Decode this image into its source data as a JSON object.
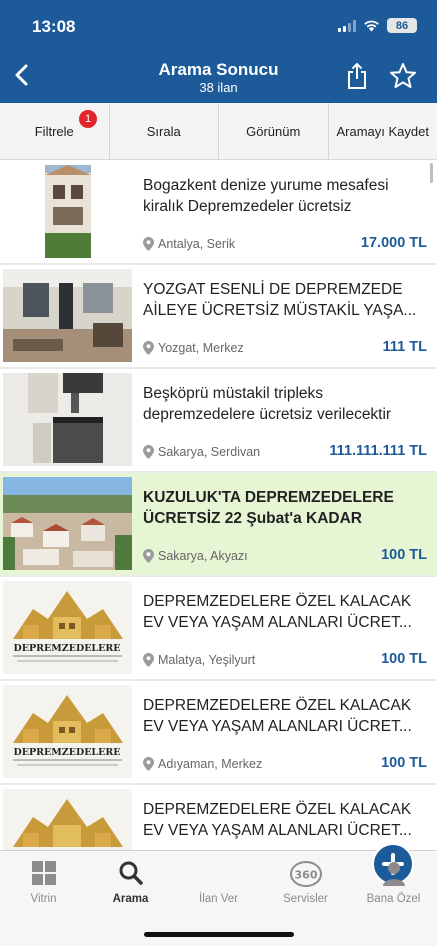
{
  "status": {
    "time": "13:08",
    "battery": "86"
  },
  "nav": {
    "title": "Arama Sonucu",
    "subtitle": "38 ilan"
  },
  "filters": [
    {
      "label": "Filtrele",
      "badge": "1"
    },
    {
      "label": "Sırala"
    },
    {
      "label": "Görünüm"
    },
    {
      "label": "Aramayı Kaydet"
    }
  ],
  "listings": [
    {
      "title": "Bogazkent denize yurume mesafesi kiralık Depremzedeler ücretsiz",
      "location": "Antalya, Serik",
      "price": "17.000 TL"
    },
    {
      "title": "YOZGAT ESENLİ DE DEPREMZEDE AİLEYE ÜCRETSİZ MÜSTAKİL YAŞA...",
      "location": "Yozgat, Merkez",
      "price": "111 TL"
    },
    {
      "title": "Beşköprü müstakil tripleks depremzedelere ücretsiz verilecektir",
      "location": "Sakarya, Serdivan",
      "price": "111.111.111 TL"
    },
    {
      "title": "KUZULUK'TA DEPREMZEDELERE ÜCRETSİZ 22 Şubat'a KADAR",
      "location": "Sakarya, Akyazı",
      "price": "100 TL"
    },
    {
      "title": "DEPREMZEDELERE ÖZEL KALACAK EV VEYA YAŞAM ALANLARI ÜCRET...",
      "location": "Malatya, Yeşilyurt",
      "price": "100 TL",
      "image_text": "DEPREMZEDELERE"
    },
    {
      "title": "DEPREMZEDELERE ÖZEL KALACAK EV VEYA YAŞAM ALANLARI ÜCRET...",
      "location": "Adıyaman, Merkez",
      "price": "100 TL",
      "image_text": "DEPREMZEDELERE"
    },
    {
      "title": "DEPREMZEDELERE ÖZEL KALACAK EV VEYA YAŞAM ALANLARI ÜCRET...",
      "location": "",
      "price": ""
    }
  ],
  "tabs": [
    {
      "label": "Vitrin",
      "icon": "grid-icon"
    },
    {
      "label": "Arama",
      "icon": "search-icon"
    },
    {
      "label": "İlan Ver",
      "icon": "plus-icon"
    },
    {
      "label": "Servisler",
      "icon": "360-icon",
      "icon_text": "360"
    },
    {
      "label": "Bana Özel",
      "icon": "user-icon"
    }
  ],
  "colors": {
    "brand": "#1c5a9a",
    "highlight": "#e6f5d4",
    "badge": "#e4262c"
  }
}
